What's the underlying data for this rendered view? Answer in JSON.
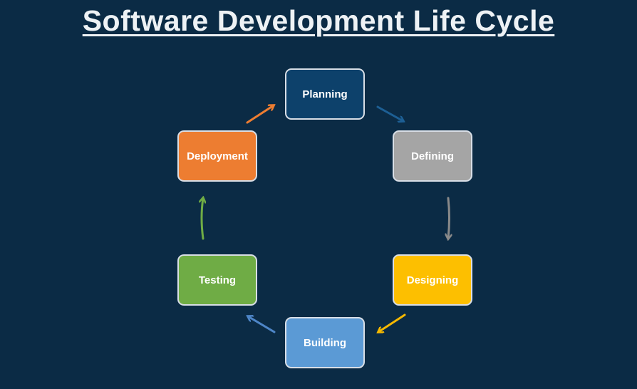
{
  "title": "Software Development Life Cycle",
  "stages": [
    {
      "label": "Planning",
      "color": "#0d416b"
    },
    {
      "label": "Defining",
      "color": "#a5a5a5"
    },
    {
      "label": "Designing",
      "color": "#fdbf00"
    },
    {
      "label": "Building",
      "color": "#5b9ad5"
    },
    {
      "label": "Testing",
      "color": "#6fac45"
    },
    {
      "label": "Deployment",
      "color": "#ed7d31"
    }
  ],
  "arrows": [
    {
      "from": "Planning",
      "to": "Defining",
      "color": "#1d5f94"
    },
    {
      "from": "Defining",
      "to": "Designing",
      "color": "#8a8a8a"
    },
    {
      "from": "Designing",
      "to": "Building",
      "color": "#f5b800"
    },
    {
      "from": "Building",
      "to": "Testing",
      "color": "#4e86c8"
    },
    {
      "from": "Testing",
      "to": "Deployment",
      "color": "#6fac45"
    },
    {
      "from": "Deployment",
      "to": "Planning",
      "color": "#ed7d31"
    }
  ]
}
